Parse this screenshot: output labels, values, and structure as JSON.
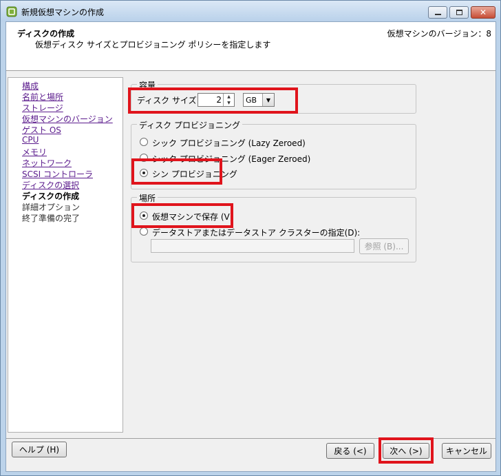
{
  "window": {
    "title": "新規仮想マシンの作成",
    "icon": "vm-wizard-icon"
  },
  "header": {
    "title": "ディスクの作成",
    "subtitle": "仮想ディスク サイズとプロビジョニング ポリシーを指定します",
    "version": "仮想マシンのバージョン：8"
  },
  "nav": {
    "items": [
      {
        "label": "構成",
        "state": "link"
      },
      {
        "label": "名前と場所",
        "state": "link"
      },
      {
        "label": "ストレージ",
        "state": "link"
      },
      {
        "label": "仮想マシンのバージョン",
        "state": "link"
      },
      {
        "label": "ゲスト OS",
        "state": "link"
      },
      {
        "label": "CPU",
        "state": "link"
      },
      {
        "label": "メモリ",
        "state": "link"
      },
      {
        "label": "ネットワーク",
        "state": "link"
      },
      {
        "label": "SCSI コントローラ",
        "state": "link"
      },
      {
        "label": "ディスクの選択",
        "state": "link"
      },
      {
        "label": "ディスクの作成",
        "state": "current"
      },
      {
        "label": "詳細オプション",
        "state": "future"
      },
      {
        "label": "終了準備の完了",
        "state": "future"
      }
    ]
  },
  "capacity": {
    "legend": "容量",
    "disk_size_label": "ディスク サイズ:",
    "disk_size_value": "2",
    "unit_value": "GB"
  },
  "provisioning": {
    "legend": "ディスク プロビジョニング",
    "options": [
      {
        "label": "シック プロビジョニング (Lazy Zeroed)",
        "selected": false
      },
      {
        "label": "シック プロビジョニング (Eager Zeroed)",
        "selected": false
      },
      {
        "label": "シン プロビジョニング",
        "selected": true
      }
    ]
  },
  "location": {
    "legend": "場所",
    "options": [
      {
        "label": "仮想マシンで保存 (V)",
        "selected": true
      },
      {
        "label": "データストアまたはデータストア クラスターの指定(D):",
        "selected": false
      }
    ],
    "datastore_value": "",
    "browse_label": "参照 (B)..."
  },
  "footer": {
    "help_label": "ヘルプ (H)",
    "back_label": "戻る (<)",
    "next_label": "次へ (>)",
    "cancel_label": "キャンセル"
  },
  "colors": {
    "highlight": "#e0141c",
    "link": "#5a1a8c"
  }
}
